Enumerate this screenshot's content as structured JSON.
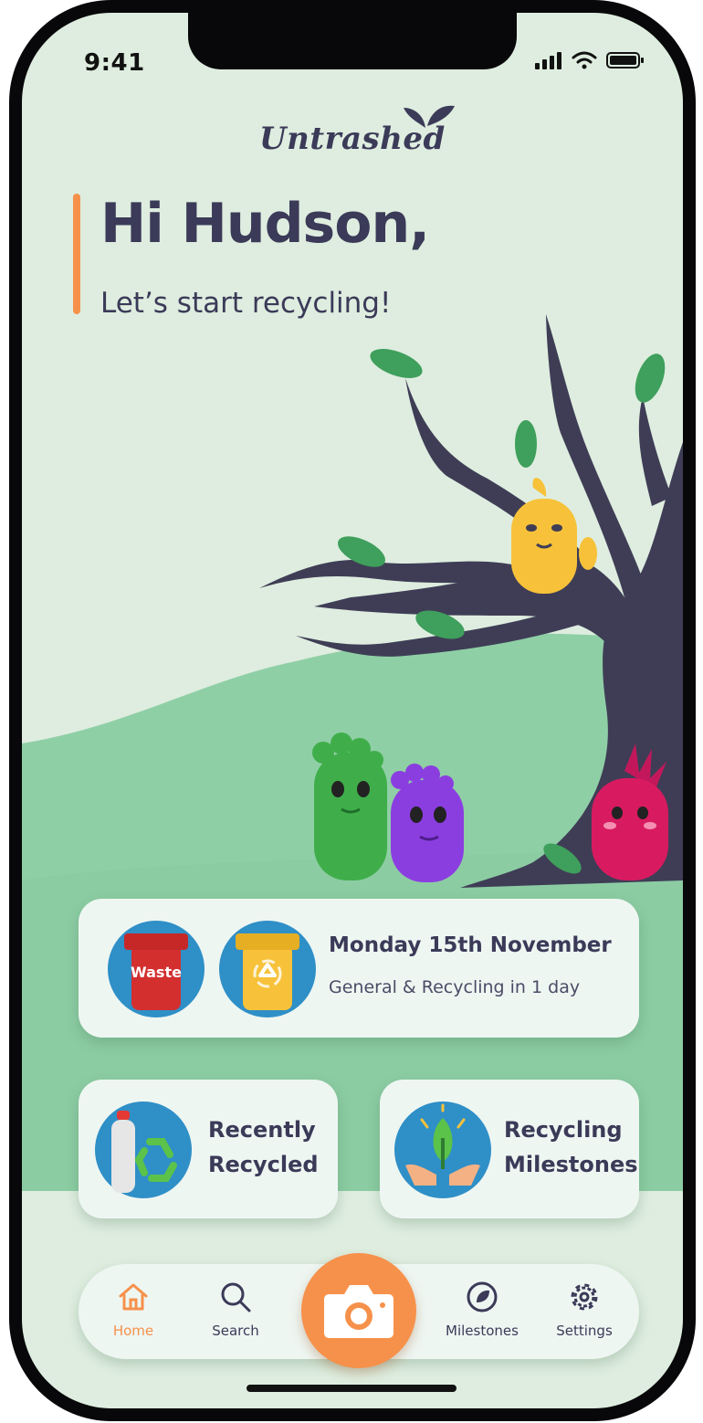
{
  "status_bar": {
    "time": "9:41"
  },
  "brand": {
    "logo_text": "Untrashed"
  },
  "header": {
    "greeting": "Hi Hudson,",
    "subtitle": "Let’s start recycling!"
  },
  "collection": {
    "bins": [
      {
        "name": "waste-bin-icon",
        "label": "Waste",
        "color": "#d32f2f"
      },
      {
        "name": "recycling-bin-icon",
        "label": "",
        "color": "#f7c23a"
      }
    ],
    "date": "Monday 15th November",
    "countdown": "General & Recycling in 1 day"
  },
  "tiles": [
    {
      "icon": "recycled-bottle-icon",
      "line1": "Recently",
      "line2": "Recycled"
    },
    {
      "icon": "plant-hands-icon",
      "line1": "Recycling",
      "line2": "Milestones"
    }
  ],
  "nav": {
    "items": [
      {
        "label": "Home",
        "icon": "home-icon",
        "active": true
      },
      {
        "label": "Search",
        "icon": "search-icon"
      },
      {
        "label": "Milestones",
        "icon": "milestones-icon"
      },
      {
        "label": "Settings",
        "icon": "settings-icon"
      }
    ],
    "camera_icon": "camera-icon"
  },
  "colors": {
    "accent": "#f6914b",
    "text": "#3b3a58",
    "background": "#deeddf",
    "hill": "#8fcfa6",
    "tree": "#3f3d56",
    "leaf": "#3f9f5c"
  }
}
